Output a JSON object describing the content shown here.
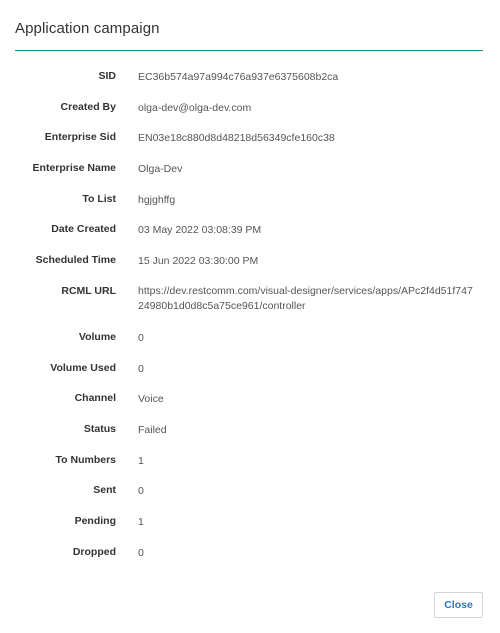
{
  "dialog": {
    "title": "Application campaign",
    "close_label": "Close"
  },
  "fields": [
    {
      "label": "SID",
      "value": "EC36b574a97a994c76a937e6375608b2ca"
    },
    {
      "label": "Created By",
      "value": "olga-dev@olga-dev.com"
    },
    {
      "label": "Enterprise Sid",
      "value": "EN03e18c880d8d48218d56349cfe160c38"
    },
    {
      "label": "Enterprise Name",
      "value": "Olga-Dev"
    },
    {
      "label": "To List",
      "value": "hgjghffg"
    },
    {
      "label": "Date Created",
      "value": "03 May 2022 03:08:39 PM"
    },
    {
      "label": "Scheduled Time",
      "value": "15 Jun 2022 03:30:00 PM"
    },
    {
      "label": "RCML URL",
      "value": "https://dev.restcomm.com/visual-designer/services/apps/APc2f4d51f74724980b1d0d8c5a75ce961/controller"
    },
    {
      "label": "Volume",
      "value": "0"
    },
    {
      "label": "Volume Used",
      "value": "0"
    },
    {
      "label": "Channel",
      "value": "Voice"
    },
    {
      "label": "Status",
      "value": "Failed"
    },
    {
      "label": "To Numbers",
      "value": "1"
    },
    {
      "label": "Sent",
      "value": "0"
    },
    {
      "label": "Pending",
      "value": "1"
    },
    {
      "label": "Dropped",
      "value": "0"
    }
  ],
  "colors": {
    "divider": "#1f8f8a",
    "button_text": "#2f74c0"
  }
}
